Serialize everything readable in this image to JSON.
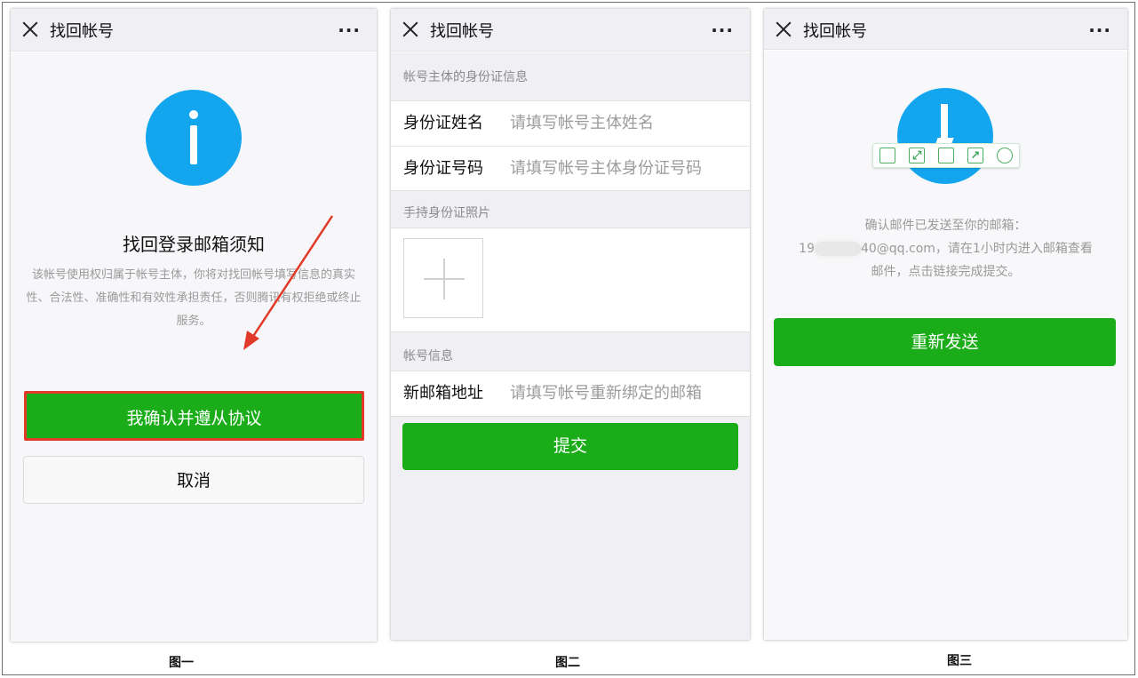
{
  "panels": [
    {
      "title": "找回帐号",
      "more": "···",
      "notice_title": "找回登录邮箱须知",
      "notice_text": "该帐号使用权归属于帐号主体，你将对找回帐号填写信息的真实性、合法性、准确性和有效性承担责任，否则腾讯有权拒绝或终止服务。",
      "confirm_button": "我确认并遵从协议",
      "cancel_button": "取消",
      "caption": "图一"
    },
    {
      "title": "找回帐号",
      "more": "···",
      "section_id": "帐号主体的身份证信息",
      "name_label": "身份证姓名",
      "name_placeholder": "请填写帐号主体姓名",
      "idnum_label": "身份证号码",
      "idnum_placeholder": "请填写帐号主体身份证号码",
      "section_photo": "手持身份证照片",
      "section_account": "帐号信息",
      "email_label": "新邮箱地址",
      "email_placeholder": "请填写帐号重新绑定的邮箱",
      "submit_button": "提交",
      "caption": "图二"
    },
    {
      "title": "找回帐号",
      "more": "···",
      "mail_line1": "确认邮件已发送至你的邮箱：",
      "mail_prefix": "19",
      "mail_suffix": "40@qq.com，请在1小时内进入邮箱查看",
      "mail_line3": "邮件，点击链接完成提交。",
      "resend_button": "重新发送",
      "caption": "图三"
    }
  ],
  "colors": {
    "primary_green": "#1aad19",
    "info_blue": "#13a6ee",
    "highlight_red": "#e23a28"
  }
}
